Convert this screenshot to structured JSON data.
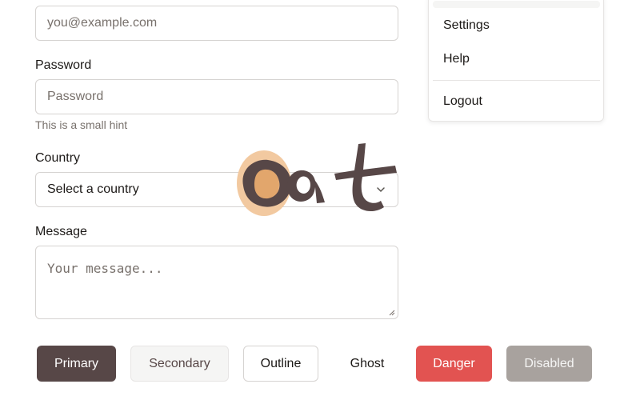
{
  "form": {
    "email": {
      "placeholder": "you@example.com"
    },
    "password": {
      "label": "Password",
      "placeholder": "Password",
      "hint": "This is a small hint"
    },
    "country": {
      "label": "Country",
      "selected": "Select a country"
    },
    "message": {
      "label": "Message",
      "placeholder": "Your message..."
    }
  },
  "menu": {
    "items": [
      "Settings",
      "Help",
      "Logout"
    ]
  },
  "buttons": {
    "primary": "Primary",
    "secondary": "Secondary",
    "outline": "Outline",
    "ghost": "Ghost",
    "danger": "Danger",
    "disabled": "Disabled"
  },
  "logo": {
    "text": "oat",
    "icon": "oat-logo"
  },
  "colors": {
    "primary": "#574747",
    "danger": "#e25351",
    "disabled": "#a8a29e",
    "logo_accent": "#f2c9a0",
    "logo_dark": "#574747"
  }
}
